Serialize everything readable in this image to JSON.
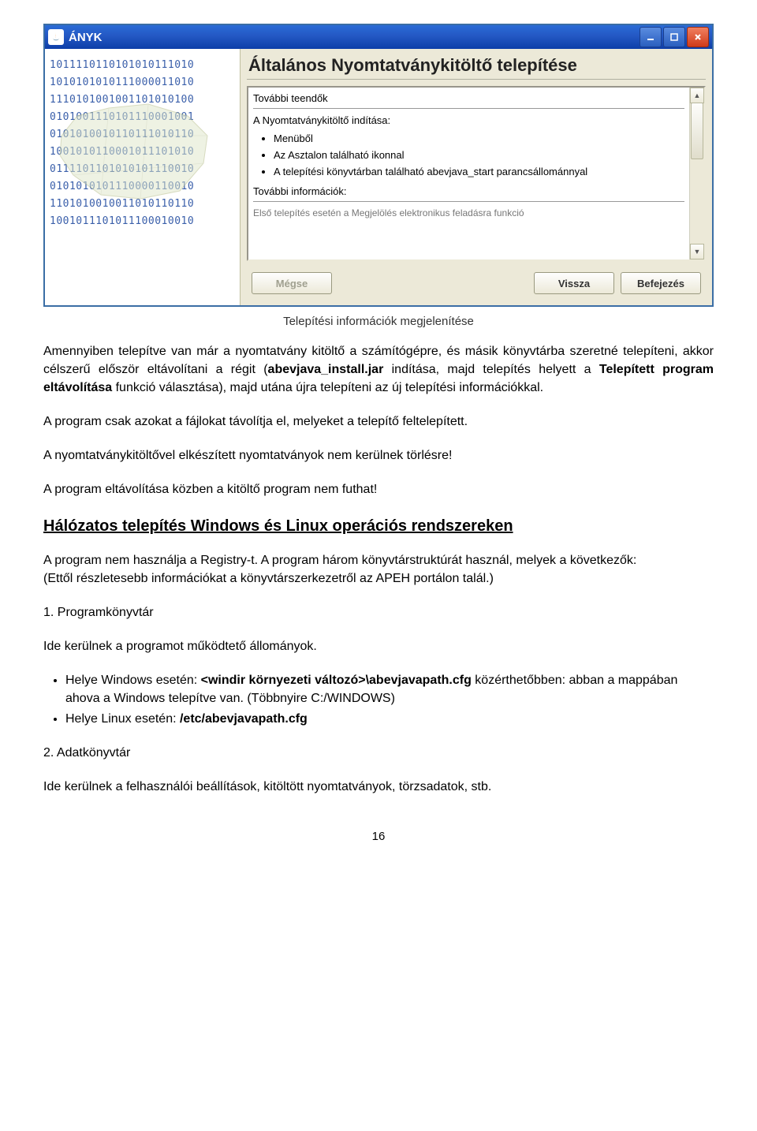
{
  "window": {
    "title": "ÁNYK"
  },
  "installer": {
    "title_heading": "Általános Nyomtatványkitöltő telepítése",
    "section1": "További teendők",
    "line1": "A Nyomtatványkitöltő indítása:",
    "bullets": {
      "b1": "Menüből",
      "b2": "Az Asztalon található ikonnal",
      "b3": "A telepítési könyvtárban található abevjava_start parancsállománnyal"
    },
    "section2": "További információk:",
    "truncated_line": "Első telepítés esetén a Megjelölés elektronikus feladásra funkció",
    "buttons": {
      "cancel": "Mégse",
      "back": "Vissza",
      "finish": "Befejezés"
    }
  },
  "binary": "1011110110101010111010\n1010101010111000011010\n1110101001001101010100\n0101001110101110001001\n0101010010110111010110\n1001010110001011101010\n0111101101010101110010\n0101010101110000110010\n1101010010011010110110\n1001011101011100010010",
  "caption": "Telepítési információk megjelenítése",
  "doc": {
    "p1a": "Amennyiben telepítve van már a nyomtatvány kitöltő a számítógépre, és másik könyvtárba szeretné telepíteni, akkor célszerű először eltávolítani a régit (",
    "p1b_bold": "abevjava_install.jar",
    "p1c": " indítása, majd telepítés helyett a ",
    "p1d_bold": "Telepített program eltávolítása",
    "p1e": " funkció választása), majd utána újra telepíteni az új telepítési információkkal.",
    "p2": "A program csak azokat a fájlokat távolítja el, melyeket a telepítő feltelepített.",
    "p3": "A nyomtatványkitöltővel elkészített nyomtatványok nem kerülnek törlésre!",
    "p4": "A program eltávolítása közben a kitöltő program nem futhat!",
    "h2": "Hálózatos telepítés Windows és Linux operációs rendszereken",
    "p5": "A program nem használja a Registry-t. A program három könyvtárstruktúrát használ, melyek a következők:",
    "p5b": "(Ettől részletesebb információkat a könyvtárszerkezetről az APEH portálon talál.)",
    "p6": "1. Programkönyvtár",
    "p7": "Ide kerülnek a programot működtető állományok.",
    "li1a": "Helye Windows esetén: ",
    "li1b_bold": "<windir környezeti változó>\\abevjavapath.cfg",
    "li1c": " közérthetőbben: abban a mappában ahova a Windows telepítve van. (Többnyire C:/WINDOWS)",
    "li2a": "Helye Linux esetén: ",
    "li2b_bold": "/etc/abevjavapath.cfg",
    "p8": "2. Adatkönyvtár",
    "p9": "Ide kerülnek a felhasználói beállítások, kitöltött nyomtatványok, törzsadatok, stb.",
    "page_number": "16"
  }
}
